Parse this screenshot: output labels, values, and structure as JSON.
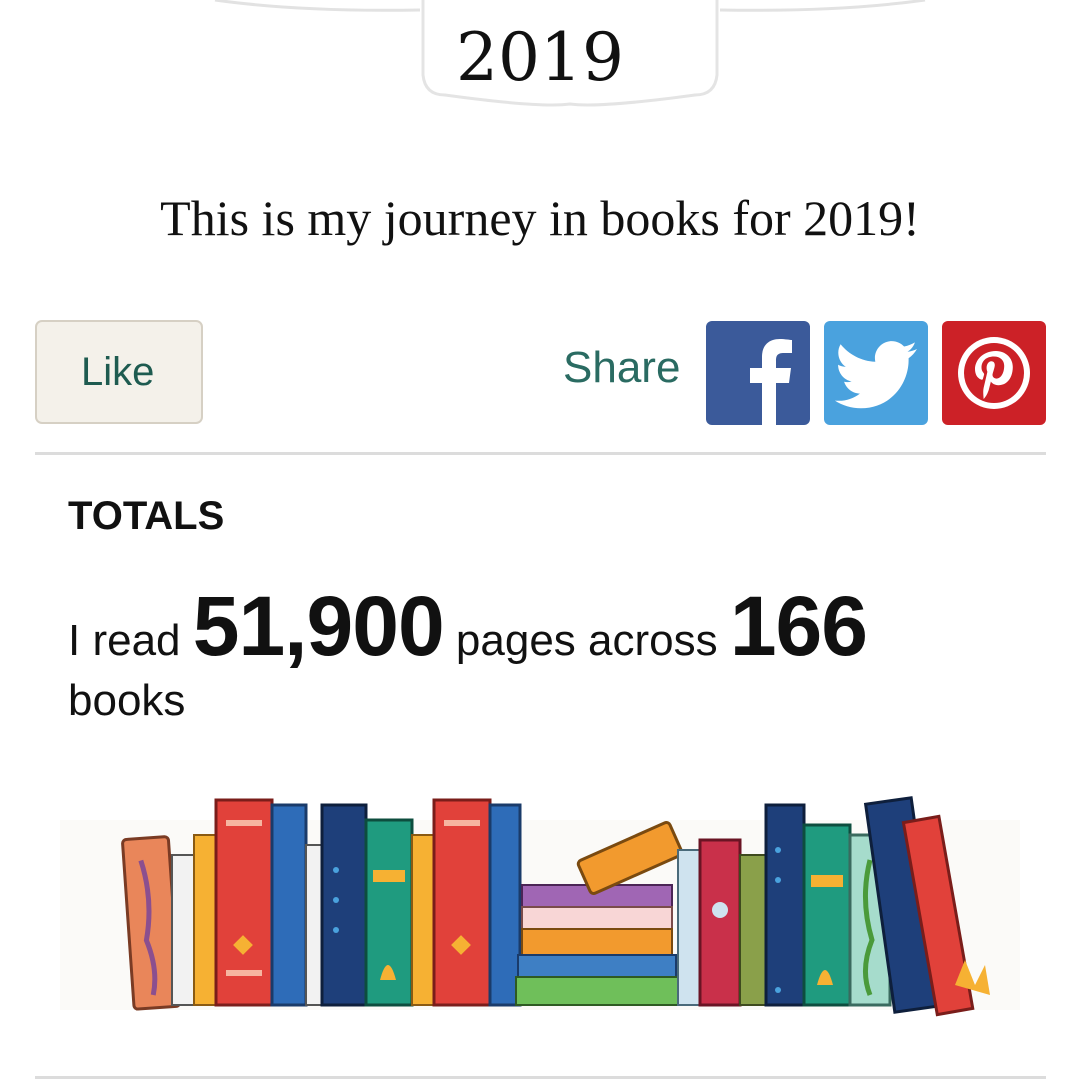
{
  "header": {
    "year": "2019"
  },
  "intro": {
    "text": "This is my journey in books for 2019!"
  },
  "actions": {
    "like_label": "Like",
    "share_label": "Share",
    "share_targets": [
      {
        "name": "facebook-icon",
        "color": "#3b5a9a"
      },
      {
        "name": "twitter-icon",
        "color": "#4aa2de"
      },
      {
        "name": "pinterest-icon",
        "color": "#cc2127"
      }
    ]
  },
  "totals": {
    "heading": "TOTALS",
    "prefix": "I read",
    "pages": "51,900",
    "middle": "pages across",
    "books_count": "166",
    "suffix": "books"
  },
  "illustration": {
    "name": "bookshelf-illustration"
  }
}
